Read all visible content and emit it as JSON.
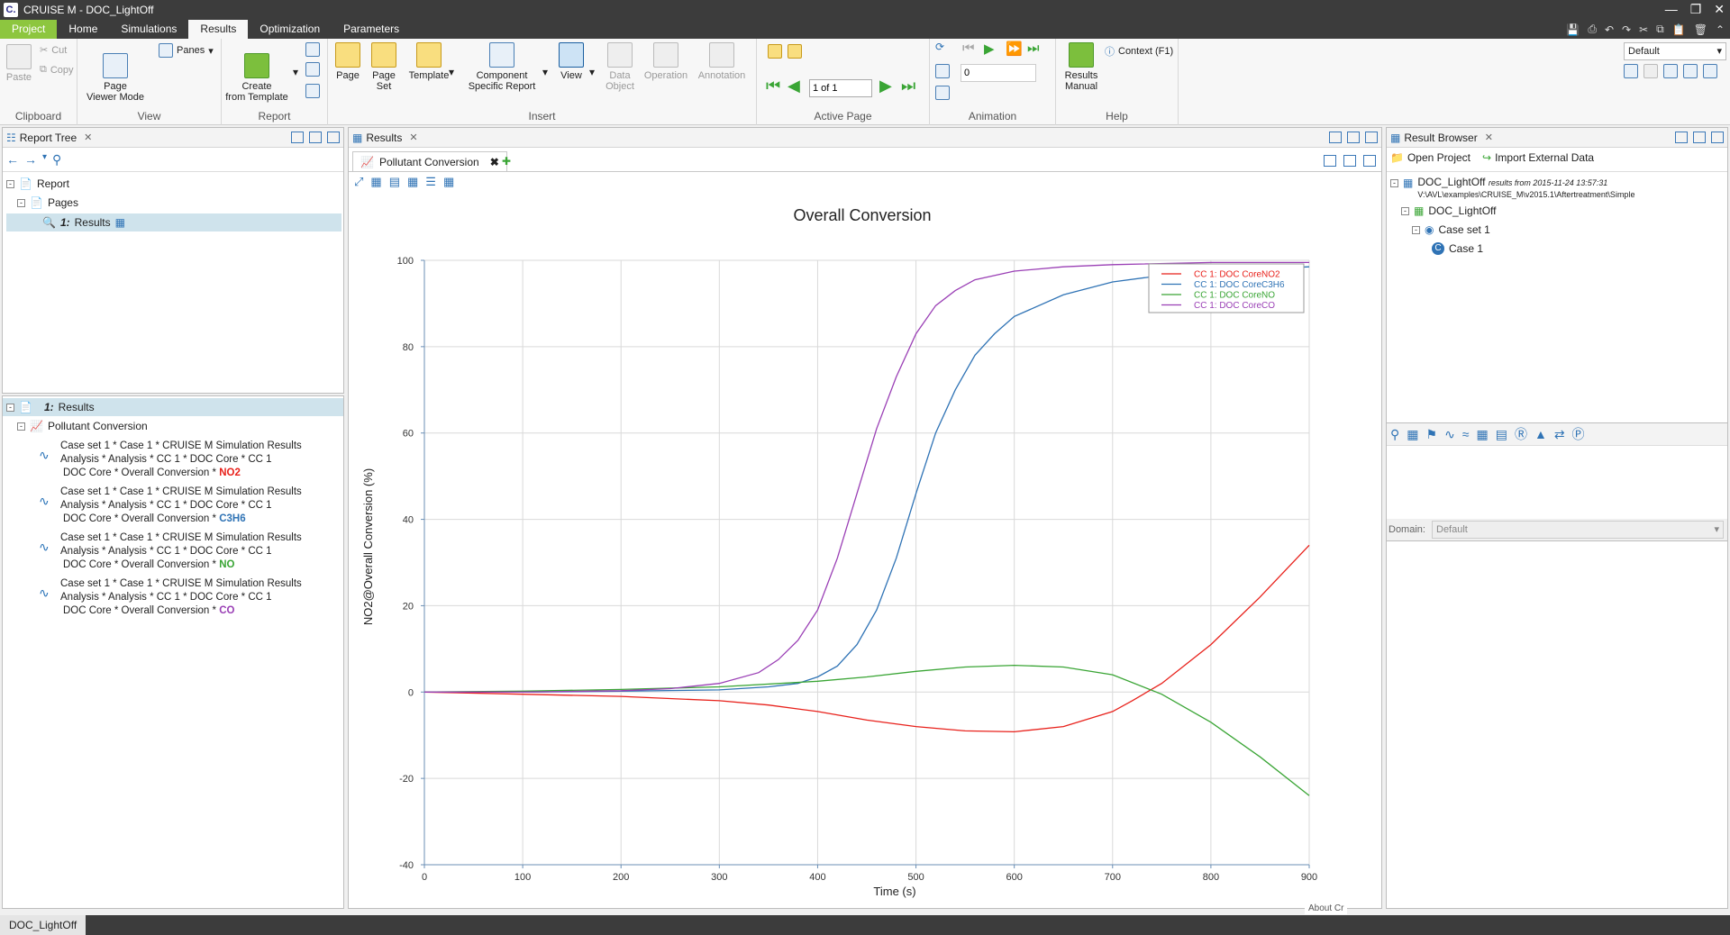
{
  "window": {
    "title": "CRUISE M - DOC_LightOff",
    "app_icon": "C."
  },
  "menu_tabs": [
    "Project",
    "Home",
    "Simulations",
    "Results",
    "Optimization",
    "Parameters"
  ],
  "ribbon": {
    "clipboard": {
      "paste": "Paste",
      "cut": "Cut",
      "copy": "Copy",
      "label": "Clipboard"
    },
    "view": {
      "page_viewer_mode": "Page\nViewer Mode",
      "panes": "Panes",
      "label": "View"
    },
    "report": {
      "create_from_template": "Create\nfrom Template",
      "label": "Report"
    },
    "insert": {
      "page": "Page",
      "page_set": "Page\nSet",
      "template": "Template",
      "component_report": "Component\nSpecific Report",
      "view": "View",
      "data_object": "Data\nObject",
      "operation": "Operation",
      "annotation": "Annotation",
      "label": "Insert"
    },
    "active_page": {
      "page_field": "1 of 1",
      "label": "Active Page"
    },
    "animation": {
      "value": "0",
      "label": "Animation"
    },
    "help": {
      "results_manual": "Results\nManual",
      "context": "Context (F1)",
      "label": "Help"
    },
    "layout_select": "Default"
  },
  "report_tree": {
    "title": "Report Tree",
    "items": [
      "Report",
      "Pages"
    ],
    "page_num": "1:",
    "page_label": "Results"
  },
  "results_tree": {
    "page_num": "1:",
    "page_label": "Results",
    "view_label": "Pollutant Conversion",
    "curves": [
      {
        "line1": "Case set 1 * Case 1 * CRUISE M Simulation Results",
        "line2": "Analysis * Analysis * CC 1 *  DOC Core * CC 1",
        "line3": "DOC Core * Overall Conversion * ",
        "species": "NO2",
        "color": "#e8211b"
      },
      {
        "line1": "Case set 1 * Case 1 * CRUISE M Simulation Results",
        "line2": "Analysis * Analysis * CC 1 *  DOC Core * CC 1",
        "line3": "DOC Core * Overall Conversion * ",
        "species": "C3H6",
        "color": "#2f73b5"
      },
      {
        "line1": "Case set 1 * Case 1 * CRUISE M Simulation Results",
        "line2": "Analysis * Analysis * CC 1 *  DOC Core * CC 1",
        "line3": "DOC Core * Overall Conversion * ",
        "species": "NO",
        "color": "#3aa535"
      },
      {
        "line1": "Case set 1 * Case 1 * CRUISE M Simulation Results",
        "line2": "Analysis * Analysis * CC 1 *  DOC Core * CC 1",
        "line3": "DOC Core * Overall Conversion * ",
        "species": "CO",
        "color": "#9a3fb5"
      }
    ]
  },
  "results_panel": {
    "title": "Results",
    "view_tab": "Pollutant Conversion"
  },
  "result_browser": {
    "title": "Result Browser",
    "open_project": "Open Project",
    "import_external": "Import External Data",
    "project_name": "DOC_LightOff",
    "project_note": "results from 2015-11-24 13:57:31",
    "project_path": "V:\\AVL\\examples\\CRUISE_M\\v2015.1\\Aftertreatment\\Simple",
    "model": "DOC_LightOff",
    "case_set": "Case set 1",
    "case": "Case 1",
    "domain_label": "Domain:",
    "domain_value": "Default"
  },
  "status": {
    "tab": "DOC_LightOff",
    "hint": "About Cr"
  },
  "chart_data": {
    "type": "line",
    "title": "Overall Conversion",
    "xlabel": "Time (s)",
    "ylabel": "NO2@Overall Conversion (%)",
    "xlim": [
      0,
      900
    ],
    "ylim": [
      -40,
      100
    ],
    "xticks": [
      0,
      100,
      200,
      300,
      400,
      500,
      600,
      700,
      800,
      900
    ],
    "yticks": [
      -40,
      -20,
      0,
      20,
      40,
      60,
      80,
      100
    ],
    "grid": true,
    "legend_position": "top-right",
    "series": [
      {
        "name": "CC 1: DOC CoreNO2",
        "color": "#e8211b",
        "x": [
          0,
          100,
          200,
          300,
          350,
          400,
          450,
          500,
          550,
          600,
          650,
          700,
          720,
          750,
          800,
          850,
          900
        ],
        "y": [
          0,
          -0.5,
          -1,
          -2,
          -3,
          -4.5,
          -6.5,
          -8,
          -9,
          -9.2,
          -8,
          -4.5,
          -2,
          2,
          11,
          22,
          34
        ]
      },
      {
        "name": "CC 1: DOC CoreC3H6",
        "color": "#2f73b5",
        "x": [
          0,
          100,
          200,
          300,
          350,
          380,
          400,
          420,
          440,
          460,
          480,
          500,
          520,
          540,
          560,
          580,
          600,
          650,
          700,
          750,
          800,
          850,
          900
        ],
        "y": [
          0,
          0,
          0.2,
          0.5,
          1.2,
          2,
          3.5,
          6,
          11,
          19,
          31,
          46,
          60,
          70,
          78,
          83,
          87,
          92,
          95,
          96.5,
          97.5,
          98,
          98.5
        ]
      },
      {
        "name": "CC 1: DOC CoreNO",
        "color": "#3aa535",
        "x": [
          0,
          100,
          200,
          300,
          400,
          450,
          500,
          550,
          600,
          650,
          700,
          750,
          800,
          850,
          900
        ],
        "y": [
          0,
          0.2,
          0.6,
          1.2,
          2.5,
          3.5,
          4.8,
          5.8,
          6.2,
          5.8,
          4,
          -0.5,
          -7,
          -15,
          -24
        ]
      },
      {
        "name": "CC 1: DOC CoreCO",
        "color": "#9a3fb5",
        "x": [
          0,
          100,
          200,
          250,
          300,
          340,
          360,
          380,
          400,
          420,
          440,
          460,
          480,
          500,
          520,
          540,
          560,
          600,
          650,
          700,
          800,
          900
        ],
        "y": [
          0,
          0,
          0.3,
          0.8,
          2,
          4.5,
          7.5,
          12,
          19,
          31,
          46,
          61,
          73,
          83,
          89.5,
          93,
          95.5,
          97.5,
          98.5,
          99,
          99.5,
          99.5
        ]
      }
    ]
  }
}
